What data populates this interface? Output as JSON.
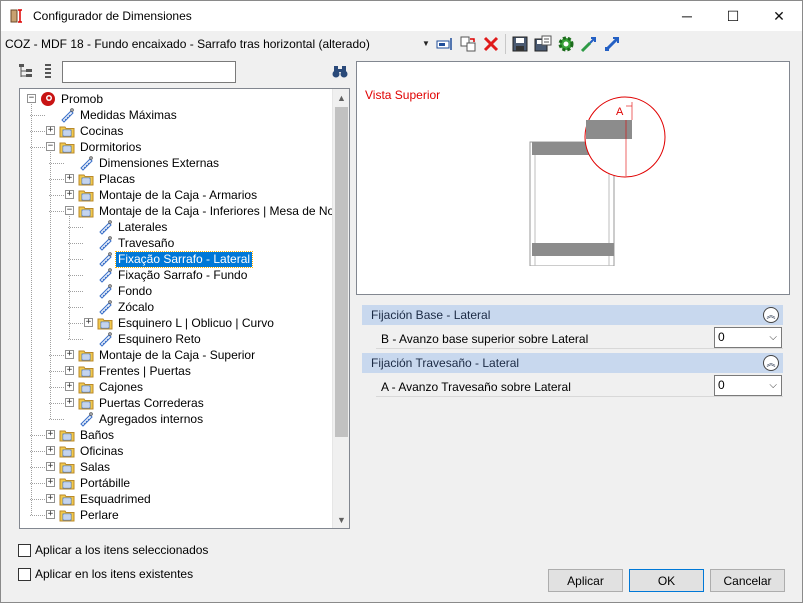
{
  "window": {
    "title": "Configurador de Dimensiones",
    "minimize": "─",
    "maximize": "☐",
    "close": "✕"
  },
  "config": {
    "selected": "COZ - MDF 18 - Fundo encaixado - Sarrafo tras horizontal (alterado)"
  },
  "search": {
    "value": ""
  },
  "tree": {
    "items": [
      {
        "label": "Promob",
        "icon": "promob-logo-icon",
        "expander": "−"
      },
      {
        "label": "Medidas Máximas",
        "icon": "ruler-tag-icon"
      },
      {
        "label": "Cocinas",
        "icon": "folder-icon",
        "expander": "+"
      },
      {
        "label": "Dormitorios",
        "icon": "folder-icon",
        "expander": "−"
      },
      {
        "label": "Dimensiones Externas",
        "icon": "ruler-tag-icon"
      },
      {
        "label": "Placas",
        "icon": "folder-icon",
        "expander": "+"
      },
      {
        "label": "Montaje de la Caja - Armarios",
        "icon": "folder-icon",
        "expander": "+"
      },
      {
        "label": "Montaje de la Caja - Inferiores | Mesa de Noche",
        "icon": "folder-icon",
        "expander": "−"
      },
      {
        "label": "Laterales",
        "icon": "ruler-tag-icon"
      },
      {
        "label": "Travesaño",
        "icon": "ruler-tag-icon"
      },
      {
        "label": "Fixação Sarrafo - Lateral",
        "icon": "ruler-tag-icon",
        "selected": true
      },
      {
        "label": "Fixação Sarrafo - Fundo",
        "icon": "ruler-tag-icon"
      },
      {
        "label": "Fondo",
        "icon": "ruler-tag-icon"
      },
      {
        "label": "Zócalo",
        "icon": "ruler-tag-icon"
      },
      {
        "label": "Esquinero L | Oblicuo | Curvo",
        "icon": "folder-icon",
        "expander": "+"
      },
      {
        "label": "Esquinero Reto",
        "icon": "ruler-tag-icon"
      },
      {
        "label": "Montaje de la Caja - Superior",
        "icon": "folder-icon",
        "expander": "+"
      },
      {
        "label": "Frentes | Puertas",
        "icon": "folder-icon",
        "expander": "+"
      },
      {
        "label": "Cajones",
        "icon": "folder-icon",
        "expander": "+"
      },
      {
        "label": "Puertas Correderas",
        "icon": "folder-icon",
        "expander": "+"
      },
      {
        "label": "Agregados internos",
        "icon": "ruler-tag-icon"
      },
      {
        "label": "Baños",
        "icon": "folder-icon",
        "expander": "+"
      },
      {
        "label": "Oficinas",
        "icon": "folder-icon",
        "expander": "+"
      },
      {
        "label": "Salas",
        "icon": "folder-icon",
        "expander": "+"
      },
      {
        "label": "Portábille",
        "icon": "folder-icon",
        "expander": "+"
      },
      {
        "label": "Esquadrimed",
        "icon": "folder-icon",
        "expander": "+"
      },
      {
        "label": "Perlare",
        "icon": "folder-icon",
        "expander": "+"
      }
    ]
  },
  "options": {
    "apply_selected": "Aplicar a los itens seleccionados",
    "apply_existing": "Aplicar en los itens existentes"
  },
  "preview": {
    "label": "Vista Superior",
    "marker": "A"
  },
  "sections": [
    {
      "title": "Fijación Base - Lateral",
      "property": {
        "label": "B - Avanzo base superior sobre Lateral",
        "value": "0"
      }
    },
    {
      "title": "Fijación Travesaño - Lateral",
      "property": {
        "label": "A - Avanzo Travesaño sobre Lateral",
        "value": "0"
      }
    }
  ],
  "buttons": {
    "apply": "Aplicar",
    "ok": "OK",
    "cancel": "Cancelar"
  },
  "colors": {
    "selection": "#0078d7",
    "section_header": "#c8d8ee",
    "preview_accent": "#e00000",
    "folder": "#f2c94c"
  }
}
